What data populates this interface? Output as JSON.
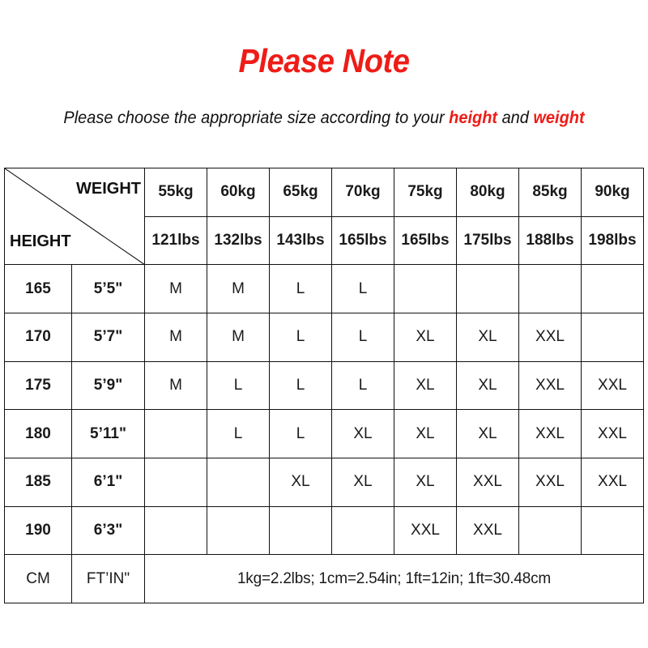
{
  "heading": {
    "title": "Please Note",
    "subtitle_before": "Please choose the appropriate size according to your ",
    "subtitle_height": "height",
    "subtitle_middle": " and ",
    "subtitle_weight": "weight",
    "title_color": "#ee1c17"
  },
  "table": {
    "corner": {
      "weight_label": "WEIGHT",
      "height_label": "HEIGHT"
    },
    "weight_kg": [
      "55kg",
      "60kg",
      "65kg",
      "70kg",
      "75kg",
      "80kg",
      "85kg",
      "90kg"
    ],
    "weight_lbs": [
      "121lbs",
      "132lbs",
      "143lbs",
      "165lbs",
      "165lbs",
      "175lbs",
      "188lbs",
      "198lbs"
    ],
    "rows": [
      {
        "height_cm": "165",
        "height_ft": "5’5\"",
        "sizes": [
          "M",
          "M",
          "L",
          "L",
          "",
          "",
          "",
          ""
        ],
        "shades": [
          "none",
          "none",
          "light",
          "light",
          "none",
          "none",
          "none",
          "none"
        ]
      },
      {
        "height_cm": "170",
        "height_ft": "5’7\"",
        "sizes": [
          "M",
          "M",
          "L",
          "L",
          "XL",
          "XL",
          "XXL",
          ""
        ],
        "shades": [
          "none",
          "none",
          "light",
          "light",
          "none",
          "none",
          "dark",
          "none"
        ]
      },
      {
        "height_cm": "175",
        "height_ft": "5’9\"",
        "sizes": [
          "M",
          "L",
          "L",
          "L",
          "XL",
          "XL",
          "XXL",
          "XXL"
        ],
        "shades": [
          "none",
          "light",
          "light",
          "light",
          "none",
          "none",
          "dark",
          "dark"
        ]
      },
      {
        "height_cm": "180",
        "height_ft": "5’11\"",
        "sizes": [
          "",
          "L",
          "L",
          "XL",
          "XL",
          "XL",
          "XXL",
          "XXL"
        ],
        "shades": [
          "none",
          "light",
          "light",
          "none",
          "none",
          "none",
          "dark",
          "dark"
        ]
      },
      {
        "height_cm": "185",
        "height_ft": "6’1\"",
        "sizes": [
          "",
          "",
          "XL",
          "XL",
          "XL",
          "XXL",
          "XXL",
          "XXL"
        ],
        "shades": [
          "none",
          "none",
          "none",
          "none",
          "none",
          "dark",
          "dark",
          "dark"
        ]
      },
      {
        "height_cm": "190",
        "height_ft": "6’3\"",
        "sizes": [
          "",
          "",
          "",
          "",
          "XXL",
          "XXL",
          "",
          ""
        ],
        "shades": [
          "none",
          "none",
          "none",
          "none",
          "dark",
          "dark",
          "none",
          "none"
        ]
      }
    ],
    "footer": {
      "unit_cm": "CM",
      "unit_ft": "FT’IN\"",
      "note": "1kg=2.2lbs; 1cm=2.54in; 1ft=12in; 1ft=30.48cm"
    },
    "shade_colors": {
      "light": "#d9d9d9",
      "dark": "#bfbfbf",
      "none": "#ffffff"
    }
  }
}
